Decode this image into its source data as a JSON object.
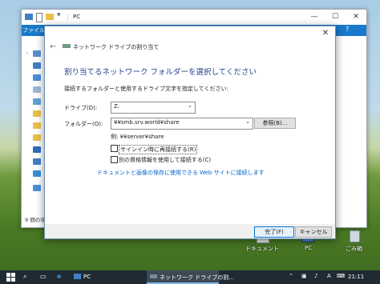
{
  "explorer": {
    "title": "PC",
    "file_tab": "ファイル",
    "status": "9 個の項目"
  },
  "dialog": {
    "title": "ネットワーク ドライブの割り当て",
    "heading": "割り当てるネットワーク フォルダーを選択してください",
    "instruction": "接続するフォルダーと使用するドライブ文字を指定してください:",
    "drive_label": "ドライブ(D):",
    "drive_value": "Z:",
    "folder_label": "フォルダー(O):",
    "folder_value": "¥¥smb.srv.world¥share",
    "browse_label": "参照(B)...",
    "example": "例: ¥¥server¥share",
    "reconnect_label": "サインイン時に再接続する(R)",
    "reconnect_checked": false,
    "credentials_label": "別の資格情報を使用して接続する(C)",
    "credentials_checked": false,
    "link_text": "ドキュメントと画像の保存に使用できる Web サイトに接続します",
    "finish_label": "完了(F)",
    "cancel_label": "キャンセル"
  },
  "desktop": {
    "icons": [
      {
        "label": "ドキュメント",
        "icon": "documents-icon"
      },
      {
        "label": "PC",
        "icon": "pc-icon"
      },
      {
        "label": "ごみ箱",
        "icon": "recycle-bin-icon"
      }
    ]
  },
  "taskbar": {
    "items": [
      {
        "label": "PC",
        "icon": "pc-icon"
      },
      {
        "label": "ネットワーク ドライブの割...",
        "icon": "network-drive-icon"
      }
    ],
    "clock": "21:11"
  },
  "colors": {
    "accent": "#1979ca",
    "heading": "#1f3f8a",
    "link": "#0066cc",
    "taskbar": "#1f2a33"
  }
}
